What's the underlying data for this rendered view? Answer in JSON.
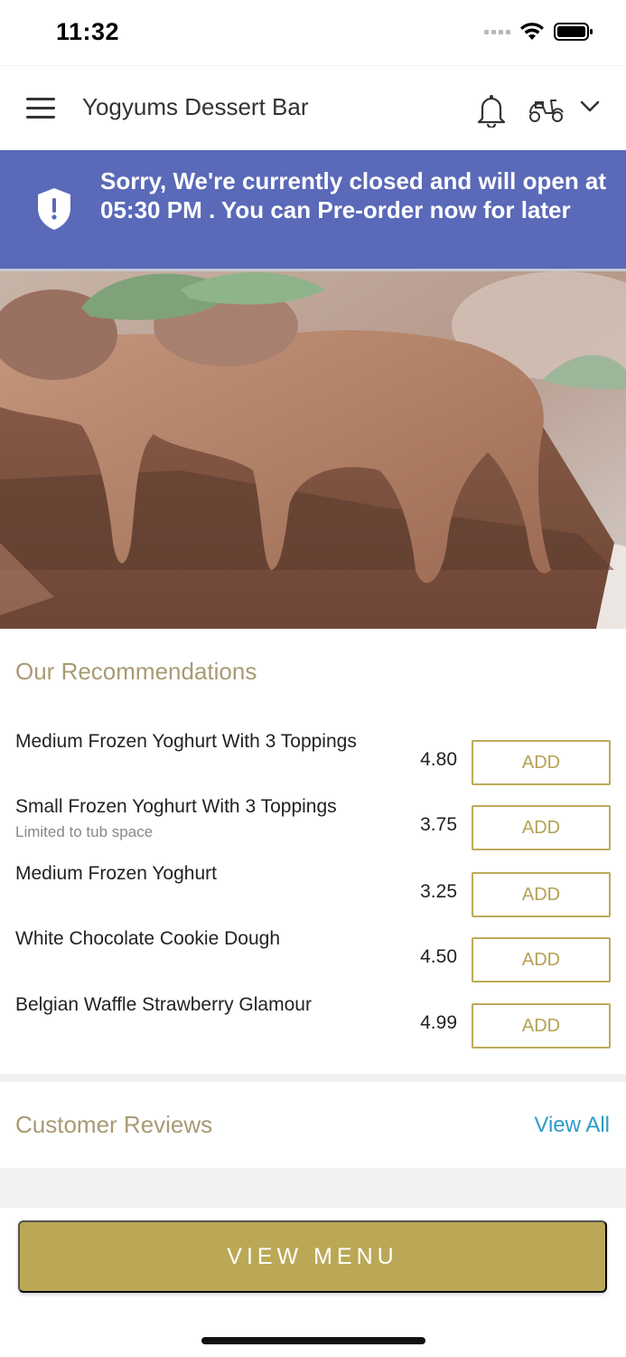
{
  "status_bar": {
    "time": "11:32"
  },
  "header": {
    "title": "Yogyums Dessert Bar",
    "icons": [
      "hamburger-menu-icon",
      "bell-icon",
      "scooter-icon",
      "chevron-down-icon"
    ]
  },
  "banner": {
    "message": "Sorry, We're currently closed and will open at 05:30 PM . You can Pre-order now for later",
    "icon": "shield-alert-icon",
    "color": "#5a69b8"
  },
  "recommendations": {
    "title": "Our Recommendations",
    "items": [
      {
        "name": "Medium Frozen Yoghurt With 3 Toppings",
        "subtitle": "",
        "price": "4.80",
        "button": "ADD"
      },
      {
        "name": "Small Frozen Yoghurt With 3 Toppings",
        "subtitle": "Limited to tub space",
        "price": "3.75",
        "button": "ADD"
      },
      {
        "name": "Medium Frozen Yoghurt",
        "subtitle": "",
        "price": "3.25",
        "button": "ADD"
      },
      {
        "name": "White Chocolate Cookie Dough",
        "subtitle": "",
        "price": "4.50",
        "button": "ADD"
      },
      {
        "name": "Belgian Waffle Strawberry Glamour",
        "subtitle": "",
        "price": "4.99",
        "button": "ADD"
      }
    ]
  },
  "reviews": {
    "title": "Customer Reviews",
    "view_all": "View All"
  },
  "footer": {
    "view_menu": "VIEW MENU"
  },
  "colors": {
    "accent_gold": "#bba856",
    "link_blue": "#2d9bc9",
    "section_title": "#a89a73"
  }
}
